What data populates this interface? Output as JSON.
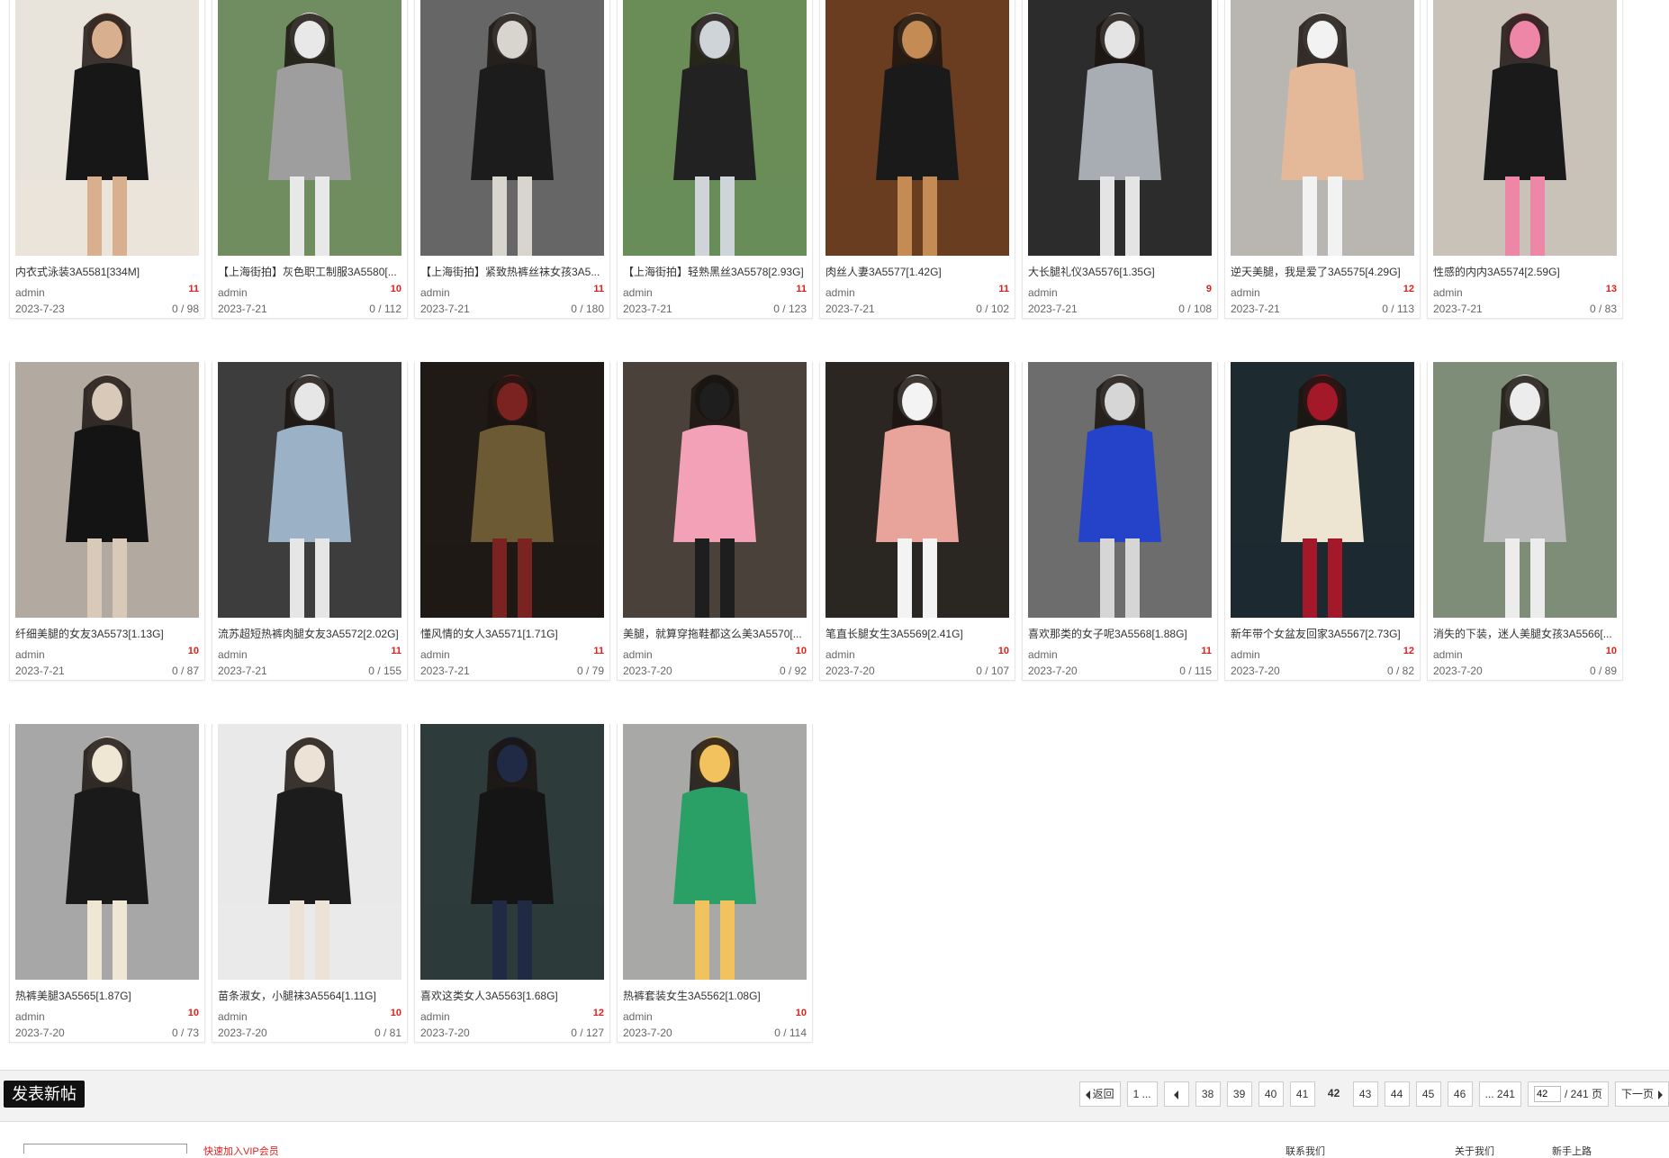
{
  "posts": [
    {
      "title": "内衣式泳装3A5581[334M]",
      "author": "admin",
      "replies": "11",
      "date": "2023-7-23",
      "views": "0 / 98",
      "colors": [
        "#e9e4db",
        "#171717",
        "#d9b08f"
      ]
    },
    {
      "title": "【上海街拍】灰色职工制服3A5580[...",
      "author": "admin",
      "replies": "10",
      "date": "2023-7-21",
      "views": "0 / 112",
      "colors": [
        "#6f8d60",
        "#9e9e9e",
        "#e8e8e8"
      ]
    },
    {
      "title": "【上海街拍】紧致热裤丝袜女孩3A5...",
      "author": "admin",
      "replies": "11",
      "date": "2023-7-21",
      "views": "0 / 180",
      "colors": [
        "#666666",
        "#1c1c1c",
        "#d8d4ce"
      ]
    },
    {
      "title": "【上海街拍】轻熟黑丝3A5578[2.93G]",
      "author": "admin",
      "replies": "11",
      "date": "2023-7-21",
      "views": "0 / 123",
      "colors": [
        "#6a8d58",
        "#222222",
        "#cfd4d9"
      ]
    },
    {
      "title": "肉丝人妻3A5577[1.42G]",
      "author": "admin",
      "replies": "11",
      "date": "2023-7-21",
      "views": "0 / 102",
      "colors": [
        "#6a3d20",
        "#1a1a1a",
        "#c58b55"
      ]
    },
    {
      "title": "大长腿礼仪3A5576[1.35G]",
      "author": "admin",
      "replies": "9",
      "date": "2023-7-21",
      "views": "0 / 108",
      "colors": [
        "#2c2c2c",
        "#a7adb3",
        "#e4e4e4"
      ]
    },
    {
      "title": "逆天美腿，我是爱了3A5575[4.29G]",
      "author": "admin",
      "replies": "12",
      "date": "2023-7-21",
      "views": "0 / 113",
      "colors": [
        "#b9b6b1",
        "#e3b99a",
        "#f2f2f2"
      ]
    },
    {
      "title": "性感的内内3A5574[2.59G]",
      "author": "admin",
      "replies": "13",
      "date": "2023-7-21",
      "views": "0 / 83",
      "colors": [
        "#c9c2b8",
        "#1a1a1a",
        "#ee86a8"
      ]
    },
    {
      "title": "纤细美腿的女友3A5573[1.13G]",
      "author": "admin",
      "replies": "10",
      "date": "2023-7-21",
      "views": "0 / 87",
      "colors": [
        "#b2aaa1",
        "#141414",
        "#d9c9b8"
      ]
    },
    {
      "title": "流苏超短热裤肉腿女友3A5572[2.02G]",
      "author": "admin",
      "replies": "11",
      "date": "2023-7-21",
      "views": "0 / 155",
      "colors": [
        "#3d3d3d",
        "#9bb2c6",
        "#e6e6e6"
      ]
    },
    {
      "title": "懂风情的女人3A5571[1.71G]",
      "author": "admin",
      "replies": "11",
      "date": "2023-7-21",
      "views": "0 / 79",
      "colors": [
        "#1f1a15",
        "#6b5a33",
        "#7b2320"
      ]
    },
    {
      "title": "美腿，就算穿拖鞋都这么美3A5570[...",
      "author": "admin",
      "replies": "10",
      "date": "2023-7-20",
      "views": "0 / 92",
      "colors": [
        "#4a423a",
        "#f2a1b7",
        "#1e1e1e"
      ]
    },
    {
      "title": "笔直长腿女生3A5569[2.41G]",
      "author": "admin",
      "replies": "10",
      "date": "2023-7-20",
      "views": "0 / 107",
      "colors": [
        "#2b2622",
        "#e8a49a",
        "#f3f3f3"
      ]
    },
    {
      "title": "喜欢那类的女子呢3A5568[1.88G]",
      "author": "admin",
      "replies": "11",
      "date": "2023-7-20",
      "views": "0 / 115",
      "colors": [
        "#6d6d6d",
        "#2443c9",
        "#d6d6d6"
      ]
    },
    {
      "title": "新年带个女盆友回家3A5567[2.73G]",
      "author": "admin",
      "replies": "12",
      "date": "2023-7-20",
      "views": "0 / 82",
      "colors": [
        "#1d2a30",
        "#ede4d2",
        "#a3192a"
      ]
    },
    {
      "title": "消失的下装，迷人美腿女孩3A5566[...",
      "author": "admin",
      "replies": "10",
      "date": "2023-7-20",
      "views": "0 / 89",
      "colors": [
        "#7d8d77",
        "#b9b9b9",
        "#ececec"
      ]
    },
    {
      "title": "热裤美腿3A5565[1.87G]",
      "author": "admin",
      "replies": "10",
      "date": "2023-7-20",
      "views": "0 / 73",
      "colors": [
        "#a7a7a7",
        "#1a1a1a",
        "#efe6d3"
      ]
    },
    {
      "title": "苗条淑女，小腿袜3A5564[1.11G]",
      "author": "admin",
      "replies": "10",
      "date": "2023-7-20",
      "views": "0 / 81",
      "colors": [
        "#e9e9e9",
        "#1c1c1c",
        "#ece3d6"
      ]
    },
    {
      "title": "喜欢这类女人3A5563[1.68G]",
      "author": "admin",
      "replies": "12",
      "date": "2023-7-20",
      "views": "0 / 127",
      "colors": [
        "#2d3b3a",
        "#151515",
        "#202a44"
      ]
    },
    {
      "title": "热裤套装女生3A5562[1.08G]",
      "author": "admin",
      "replies": "10",
      "date": "2023-7-20",
      "views": "0 / 114",
      "colors": [
        "#a8a9a6",
        "#2aa066",
        "#f2c25e"
      ]
    }
  ],
  "post_button": "发表新帖",
  "pagination": {
    "back": "返回",
    "first": "1 ...",
    "pages": [
      "38",
      "39",
      "40",
      "41",
      "42",
      "43",
      "44",
      "45",
      "46"
    ],
    "current": "42",
    "last": "... 241",
    "input_value": "42",
    "total": "/ 241 页",
    "next": "下一页"
  },
  "footer": {
    "notice": "快速加入VIP会员",
    "link1": "联系我们",
    "link2": "关于我们",
    "link3": "新手上路"
  }
}
